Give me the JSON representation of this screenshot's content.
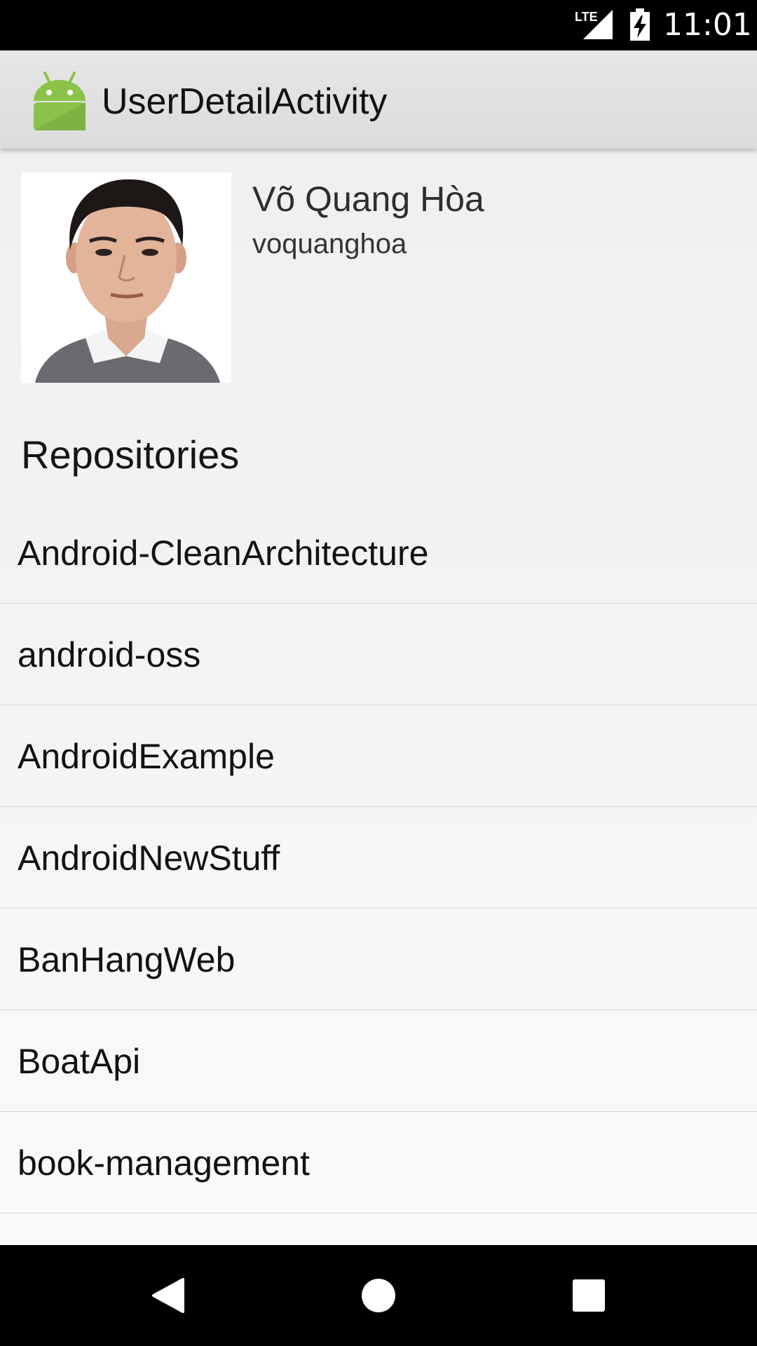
{
  "status_bar": {
    "network_label": "LTE",
    "time": "11:01",
    "icons": [
      "lte-signal-icon",
      "battery-charging-icon"
    ]
  },
  "app_bar": {
    "icon": "android-logo-icon",
    "title": "UserDetailActivity",
    "colors": {
      "background": "#dddddd",
      "logo": "#8bc34a"
    }
  },
  "profile": {
    "full_name": "Võ Quang Hòa",
    "username": "voquanghoa"
  },
  "repositories": {
    "heading": "Repositories",
    "items": [
      {
        "name": "Android-CleanArchitecture"
      },
      {
        "name": "android-oss"
      },
      {
        "name": "AndroidExample"
      },
      {
        "name": "AndroidNewStuff"
      },
      {
        "name": "BanHangWeb"
      },
      {
        "name": "BoatApi"
      },
      {
        "name": "book-management"
      }
    ]
  },
  "nav_bar": {
    "buttons": [
      "back-icon",
      "home-icon",
      "recent-apps-icon"
    ]
  }
}
